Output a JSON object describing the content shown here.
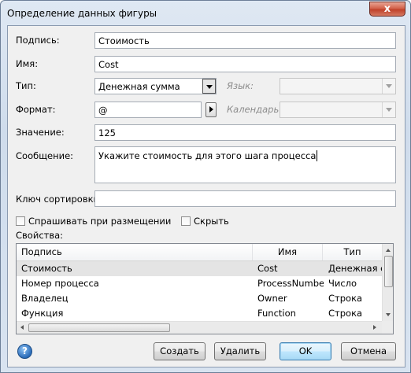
{
  "window": {
    "title": "Определение данных фигуры",
    "close_glyph": "x"
  },
  "form": {
    "caption_label": "Подпись:",
    "caption_value": "Стоимость",
    "name_label": "Имя:",
    "name_value": "Cost",
    "type_label": "Тип:",
    "type_value": "Денежная сумма",
    "language_label": "Язык:",
    "language_value": "",
    "format_label": "Формат:",
    "format_value": "@",
    "calendar_label": "Календарь:",
    "calendar_value": "",
    "value_label": "Значение:",
    "value_value": "125",
    "prompt_label": "Сообщение:",
    "prompt_value": "Укажите стоимость для этого шага процесса",
    "sort_key_label": "Ключ сортировки:",
    "sort_key_value": "",
    "ask_on_drop_label": "Спрашивать при размещении",
    "ask_on_drop_checked": false,
    "hidden_label": "Скрыть",
    "hidden_checked": false,
    "properties_label": "Свойства:"
  },
  "properties_table": {
    "columns": [
      "Подпись",
      "Имя",
      "Тип"
    ],
    "rows": [
      {
        "caption": "Стоимость",
        "name": "Cost",
        "type": "Денежная сумма",
        "selected": true
      },
      {
        "caption": "Номер процесса",
        "name": "ProcessNumber",
        "type": "Число",
        "selected": false
      },
      {
        "caption": "Владелец",
        "name": "Owner",
        "type": "Строка",
        "selected": false
      },
      {
        "caption": "Функция",
        "name": "Function",
        "type": "Строка",
        "selected": false
      }
    ]
  },
  "buttons": {
    "help": "?",
    "create": "Создать",
    "delete": "Удалить",
    "ok": "OK",
    "cancel": "Отмена"
  },
  "icons": {
    "help": "help-icon",
    "close": "close-icon",
    "dropdown": "chevron-down-icon",
    "format_picker": "play-arrow-icon"
  }
}
